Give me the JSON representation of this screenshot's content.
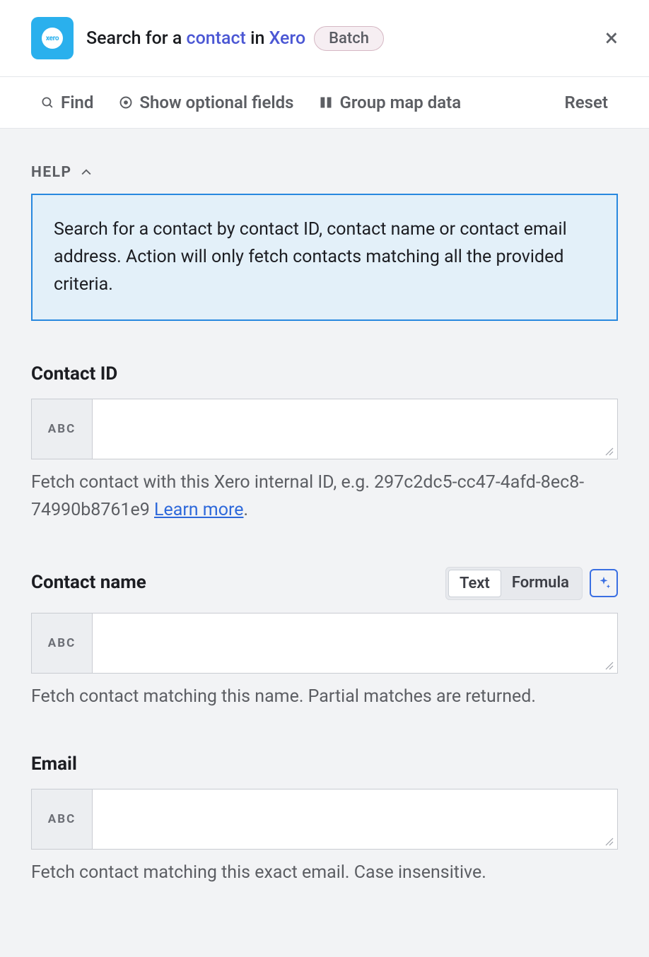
{
  "header": {
    "app_logo_text": "xero",
    "title_prefix": "Search for a ",
    "title_link1": "contact",
    "title_middle": " in ",
    "title_link2": "Xero",
    "badge": "Batch"
  },
  "toolbar": {
    "find": "Find",
    "show_optional": "Show optional fields",
    "group_map": "Group map data",
    "reset": "Reset"
  },
  "help": {
    "label": "HELP",
    "text": "Search for a contact by contact ID, contact name or contact email address. Action will only fetch contacts matching all the provided criteria."
  },
  "fields": {
    "contact_id": {
      "label": "Contact ID",
      "prefix": "ABC",
      "value": "",
      "hint_prefix": "Fetch contact with this Xero internal ID, e.g. 297c2dc5-cc47-4afd-8ec8-74990b8761e9 ",
      "hint_link": "Learn more",
      "hint_suffix": "."
    },
    "contact_name": {
      "label": "Contact name",
      "prefix": "ABC",
      "value": "",
      "toggle": {
        "text": "Text",
        "formula": "Formula"
      },
      "hint": "Fetch contact matching this name. Partial matches are returned."
    },
    "email": {
      "label": "Email",
      "prefix": "ABC",
      "value": "",
      "hint": "Fetch contact matching this exact email. Case insensitive."
    }
  }
}
